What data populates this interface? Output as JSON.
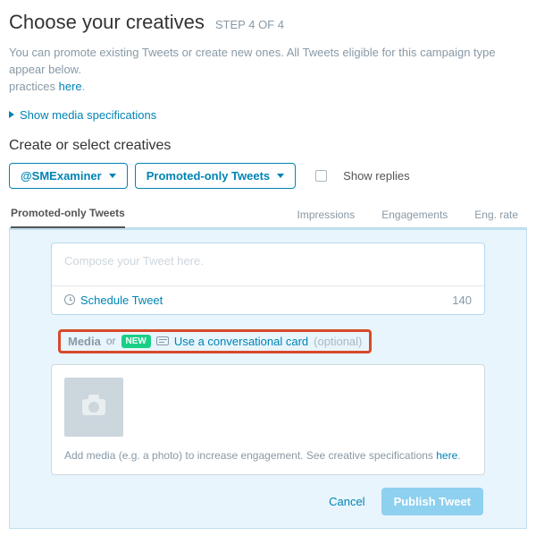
{
  "header": {
    "title": "Choose your creatives",
    "step": "STEP 4 OF 4"
  },
  "intro": {
    "line": "You can promote existing Tweets or create new ones. All Tweets eligible for this campaign type appear below.",
    "prefix2": "practices ",
    "here": "here",
    "dot": "."
  },
  "spec_link": "Show media specifications",
  "section_title": "Create or select creatives",
  "controls": {
    "account": "@SMExaminer",
    "filter": "Promoted-only Tweets",
    "show_replies": "Show replies"
  },
  "tabs": {
    "active": "Promoted-only Tweets",
    "cols": {
      "impressions": "Impressions",
      "engagements": "Engagements",
      "eng_rate": "Eng. rate"
    }
  },
  "compose": {
    "placeholder": "Compose your Tweet here.",
    "schedule": "Schedule Tweet",
    "count": "140"
  },
  "media_row": {
    "media": "Media",
    "or": "or",
    "new": "NEW",
    "link": "Use a conversational card",
    "optional": "(optional)"
  },
  "media_card": {
    "hint_pre": "Add media (e.g. a photo) to increase engagement. See creative specifications ",
    "here": "here",
    "dot": "."
  },
  "actions": {
    "cancel": "Cancel",
    "publish": "Publish Tweet"
  }
}
